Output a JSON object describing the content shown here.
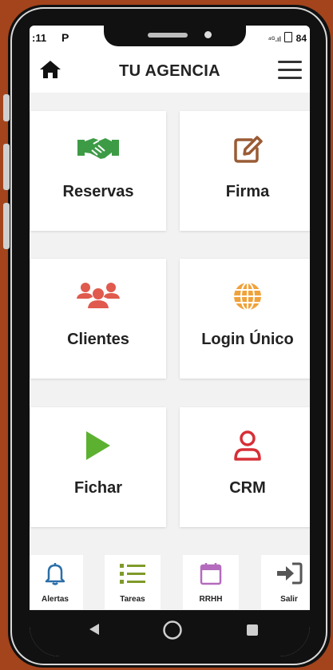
{
  "status_bar": {
    "time": ":11",
    "app_indicator": "P",
    "signal_info": "⁴ᴳ.ıl",
    "battery": "84"
  },
  "header": {
    "title": "TU AGENCIA",
    "left_icon": "home-icon",
    "right_icon": "hamburger-menu-icon"
  },
  "tiles": [
    {
      "label": "Reservas",
      "icon": "handshake-icon",
      "color": "#3d9b46"
    },
    {
      "label": "Firma",
      "icon": "edit-icon",
      "color": "#9a5b35"
    },
    {
      "label": "Clientes",
      "icon": "users-icon",
      "color": "#e05a4e"
    },
    {
      "label": "Login Único",
      "icon": "globe-icon",
      "color": "#f0a23a"
    },
    {
      "label": "Fichar",
      "icon": "play-icon",
      "color": "#5cb130"
    },
    {
      "label": "CRM",
      "icon": "user-icon",
      "color": "#d62f36"
    }
  ],
  "bottom_nav": [
    {
      "label": "Alertas",
      "icon": "bell-icon",
      "color": "#2b6ea8"
    },
    {
      "label": "Tareas",
      "icon": "list-icon",
      "color": "#7f9a2a"
    },
    {
      "label": "RRHH",
      "icon": "calendar-icon",
      "color": "#b46bbd"
    },
    {
      "label": "Salir",
      "icon": "sign-in-icon",
      "color": "#555555"
    }
  ],
  "system_nav": {
    "back": "back-icon",
    "home": "home-circle-icon",
    "recents": "recents-icon"
  }
}
